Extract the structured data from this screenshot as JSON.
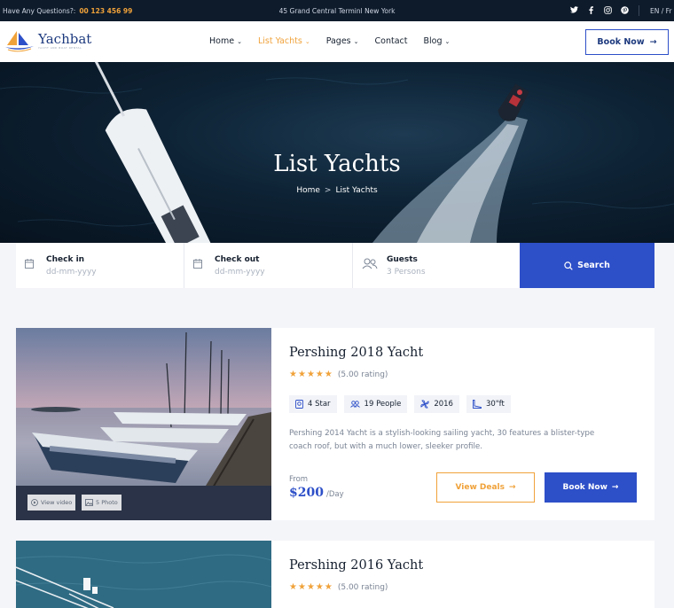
{
  "topbar": {
    "question": "Have Any Questions?:",
    "phone": "00 123 456 99",
    "address": "45 Grand Central Terminl New York",
    "social": [
      "twitter-icon",
      "facebook-icon",
      "instagram-icon",
      "pinterest-icon"
    ],
    "language": "EN / Fr"
  },
  "header": {
    "logo_name": "Yachbat",
    "logo_tagline": "YACHT AND BOAT RENTAL",
    "nav": [
      {
        "label": "Home"
      },
      {
        "label": "List Yachts"
      },
      {
        "label": "Pages"
      },
      {
        "label": "Contact"
      },
      {
        "label": "Blog"
      }
    ],
    "book_label": "Book Now"
  },
  "hero": {
    "title": "List Yachts",
    "breadcrumb_home": "Home",
    "breadcrumb_sep": ">",
    "breadcrumb_current": "List Yachts"
  },
  "search": {
    "checkin_label": "Check in",
    "checkin_placeholder": "dd-mm-yyyy",
    "checkout_label": "Check out",
    "checkout_placeholder": "dd-mm-yyyy",
    "guests_label": "Guests",
    "guests_value": "3 Persons",
    "search_label": "Search"
  },
  "listings": [
    {
      "title": "Pershing 2018 Yacht",
      "rating_text": "(5.00 rating)",
      "features": [
        "4 Star",
        "19 People",
        "2016",
        "30\"ft"
      ],
      "description": "Pershing 2014 Yacht is a stylish-looking sailing yacht, 30 features a blister-type coach roof, but with a much lower, sleeker profile.",
      "from_label": "From",
      "price": "$200",
      "per": "/Day",
      "view_deals": "View Deals",
      "book_now": "Book Now",
      "video_label": "View video",
      "photo_label": "5 Photo"
    },
    {
      "title": "Pershing 2016 Yacht",
      "rating_text": "(5.00 rating)"
    }
  ],
  "colors": {
    "accent_blue": "#2d4fc8",
    "accent_orange": "#f0a23a",
    "dark": "#0e1b2b"
  }
}
